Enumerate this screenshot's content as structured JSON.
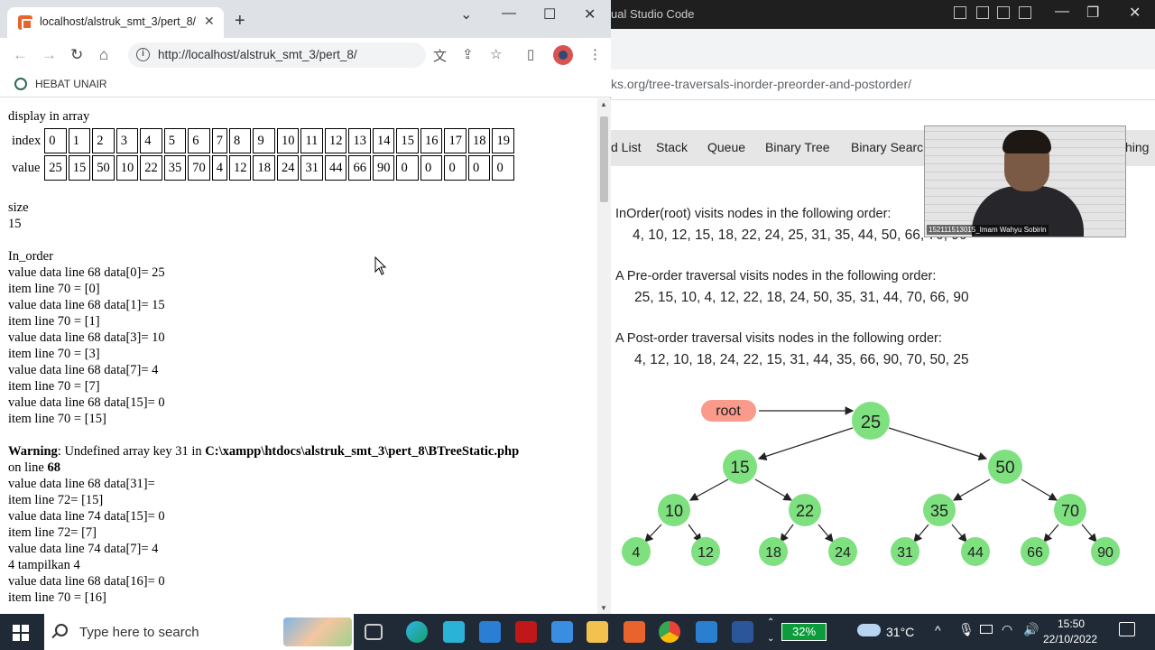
{
  "browser": {
    "tab_title": "localhost/alstruk_smt_3/pert_8/",
    "url": "http://localhost/alstruk_smt_3/pert_8/",
    "bookmark": "HEBAT UNAIR"
  },
  "page": {
    "array_heading": "display in array",
    "index_label": "index",
    "value_label": "value",
    "indexes": [
      "0",
      "1",
      "2",
      "3",
      "4",
      "5",
      "6",
      "7",
      "8",
      "9",
      "10",
      "11",
      "12",
      "13",
      "14",
      "15",
      "16",
      "17",
      "18",
      "19"
    ],
    "values": [
      "25",
      "15",
      "50",
      "10",
      "22",
      "35",
      "70",
      "4",
      "12",
      "18",
      "24",
      "31",
      "44",
      "66",
      "90",
      "0",
      "0",
      "0",
      "0",
      "0"
    ],
    "size_label": "size",
    "size_value": "15",
    "inorder_label": "In_order",
    "lines_a": [
      "value data line 68 data[0]= 25",
      "item line 70 = [0]",
      "value data line 68 data[1]= 15",
      "item line 70 = [1]",
      "value data line 68 data[3]= 10",
      "item line 70 = [3]",
      "value data line 68 data[7]= 4",
      "item line 70 = [7]",
      "value data line 68 data[15]= 0",
      "item line 70 = [15]"
    ],
    "warning_label": "Warning",
    "warning_mid": ": Undefined array key 31 in ",
    "warning_path": "C:\\xampp\\htdocs\\alstruk_smt_3\\pert_8\\BTreeStatic.php",
    "warning_on": "on line ",
    "warning_line": "68",
    "lines_b": [
      "value data line 68 data[31]=",
      "item line 72= [15]",
      "value data line 74 data[15]= 0",
      "item line 72= [7]",
      "value data line 74 data[7]= 4",
      "4 tampilkan 4",
      "value data line 68 data[16]= 0",
      "item line 70 = [16]"
    ]
  },
  "bg_window": {
    "vscode_title": "ual Studio Code",
    "url_fragment": "ks.org/tree-traversals-inorder-preorder-and-postorder/",
    "nav_items": [
      "d List",
      "Stack",
      "Queue",
      "Binary Tree",
      "Binary Searc",
      "hing"
    ],
    "inorder_text": "InOrder(root) visits nodes in the following order:",
    "inorder_values": "4, 10, 12, 15, 18, 22, 24, 25, 31, 35, 44, 50, 66, 70, 90",
    "preorder_text": "A Pre-order traversal visits nodes in the following order:",
    "preorder_values": "25, 15, 10, 4, 12, 22, 18, 24, 50, 35, 31, 44, 70, 66, 90",
    "postorder_text": "A Post-order traversal visits nodes in the following order:",
    "postorder_values": "4, 12, 10, 18, 24, 22, 15, 31, 44, 35, 66, 90, 70, 50, 25",
    "webcam_label": "152111513015_Imam Wahyu Sobirin",
    "tree_root_label": "root",
    "tree_nodes": [
      "25",
      "15",
      "50",
      "10",
      "22",
      "35",
      "70",
      "4",
      "12",
      "18",
      "24",
      "31",
      "44",
      "66",
      "90"
    ],
    "colors": {
      "node": "#7fe07f",
      "root_label": "#f99a8a"
    }
  },
  "taskbar": {
    "search_placeholder": "Type here to search",
    "battery": "32%",
    "weather": "31°C",
    "time": "15:50",
    "date": "22/10/2022"
  }
}
